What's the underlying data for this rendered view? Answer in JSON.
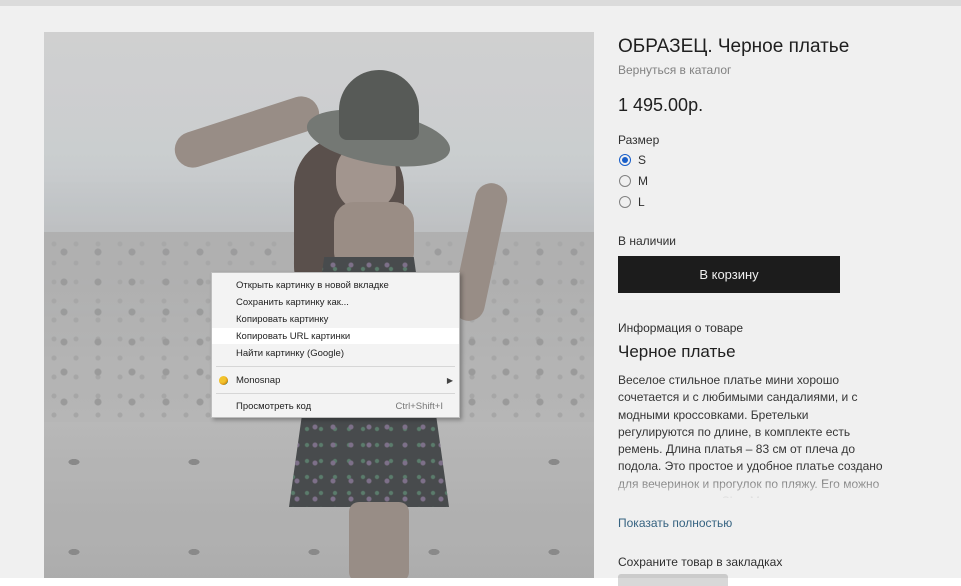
{
  "product": {
    "title": "ОБРАЗЕЦ. Черное платье",
    "back_link": "Вернуться в каталог",
    "price": "1 495.00р.",
    "size_label": "Размер",
    "sizes": [
      "S",
      "M",
      "L"
    ],
    "selected_size": "S",
    "stock": "В наличии",
    "cart_button": "В корзину",
    "info_label": "Информация о товаре",
    "info_title": "Черное платье",
    "description": "Веселое стильное платье мини хорошо сочетается и с любимыми сандалиями, и с модными кроссовками. Бретельки регулируются по длине, в комплекте есть ремень. Длина платья – 83 см от плеча до подола. Это простое и удобное платье создано для вечеринок и прогулок по пляжу. Его можно купить в магазине ShopMe",
    "show_more": "Показать полностью",
    "bookmark_label": "Сохраните товар в закладках"
  },
  "context_menu": {
    "items": [
      {
        "label": "Открыть картинку в новой вкладке"
      },
      {
        "label": "Сохранить картинку как..."
      },
      {
        "label": "Копировать картинку"
      },
      {
        "label": "Копировать URL картинки",
        "highlighted": true
      },
      {
        "label": "Найти картинку (Google)"
      },
      {
        "label": "Monosnap",
        "icon": "monosnap-icon",
        "submenu": true
      },
      {
        "label": "Просмотреть код",
        "shortcut": "Ctrl+Shift+I"
      }
    ]
  },
  "colors": {
    "button_bg": "#1e1e1e",
    "radio_accent": "#1a64d6",
    "link": "#3a6a8a"
  }
}
